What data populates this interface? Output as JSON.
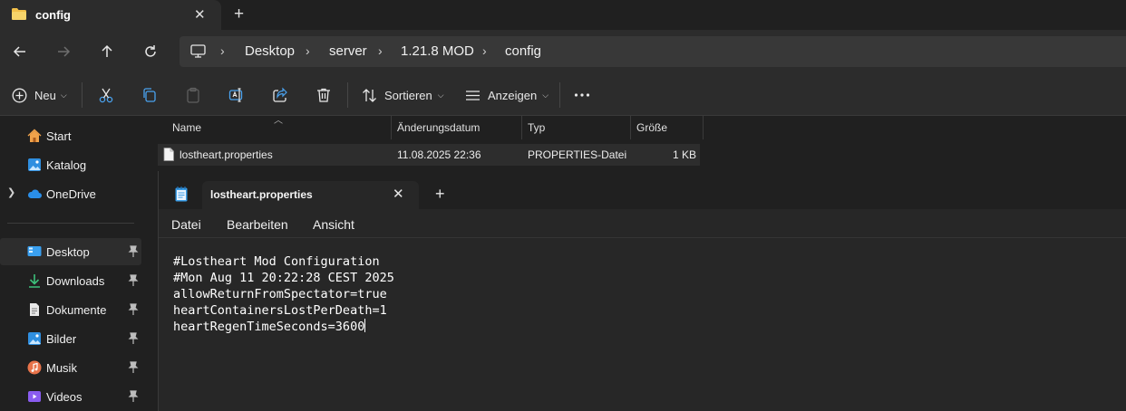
{
  "explorer": {
    "tab_title": "config",
    "breadcrumbs": [
      "Desktop",
      "server",
      "1.21.8 MOD",
      "config"
    ],
    "commands": {
      "new_label": "Neu",
      "sort_label": "Sortieren",
      "view_label": "Anzeigen"
    },
    "sidebar": {
      "top": [
        {
          "label": "Start",
          "icon": "home-icon"
        },
        {
          "label": "Katalog",
          "icon": "gallery-icon"
        },
        {
          "label": "OneDrive",
          "icon": "cloud-icon"
        }
      ],
      "pinned": [
        {
          "label": "Desktop",
          "icon": "desktop-icon",
          "selected": true
        },
        {
          "label": "Downloads",
          "icon": "download-icon"
        },
        {
          "label": "Dokumente",
          "icon": "document-icon"
        },
        {
          "label": "Bilder",
          "icon": "pictures-icon"
        },
        {
          "label": "Musik",
          "icon": "music-icon"
        },
        {
          "label": "Videos",
          "icon": "video-icon"
        }
      ]
    },
    "columns": [
      "Name",
      "Änderungsdatum",
      "Typ",
      "Größe"
    ],
    "files": [
      {
        "name": "lostheart.properties",
        "modified": "11.08.2025 22:36",
        "type": "PROPERTIES-Datei",
        "size": "1 KB"
      }
    ]
  },
  "notepad": {
    "tab_title": "lostheart.properties",
    "menu": [
      "Datei",
      "Bearbeiten",
      "Ansicht"
    ],
    "lines": [
      "#Lostheart Mod Configuration",
      "#Mon Aug 11 20:22:28 CEST 2025",
      "allowReturnFromSpectator=true",
      "heartContainersLostPerDeath=1",
      "heartRegenTimeSeconds=3600"
    ]
  },
  "colors": {
    "background": "#202020",
    "panel": "#2c2c2c",
    "address": "#383838",
    "folder": "#f2c04a",
    "accent_blue": "#4aa3f0"
  }
}
